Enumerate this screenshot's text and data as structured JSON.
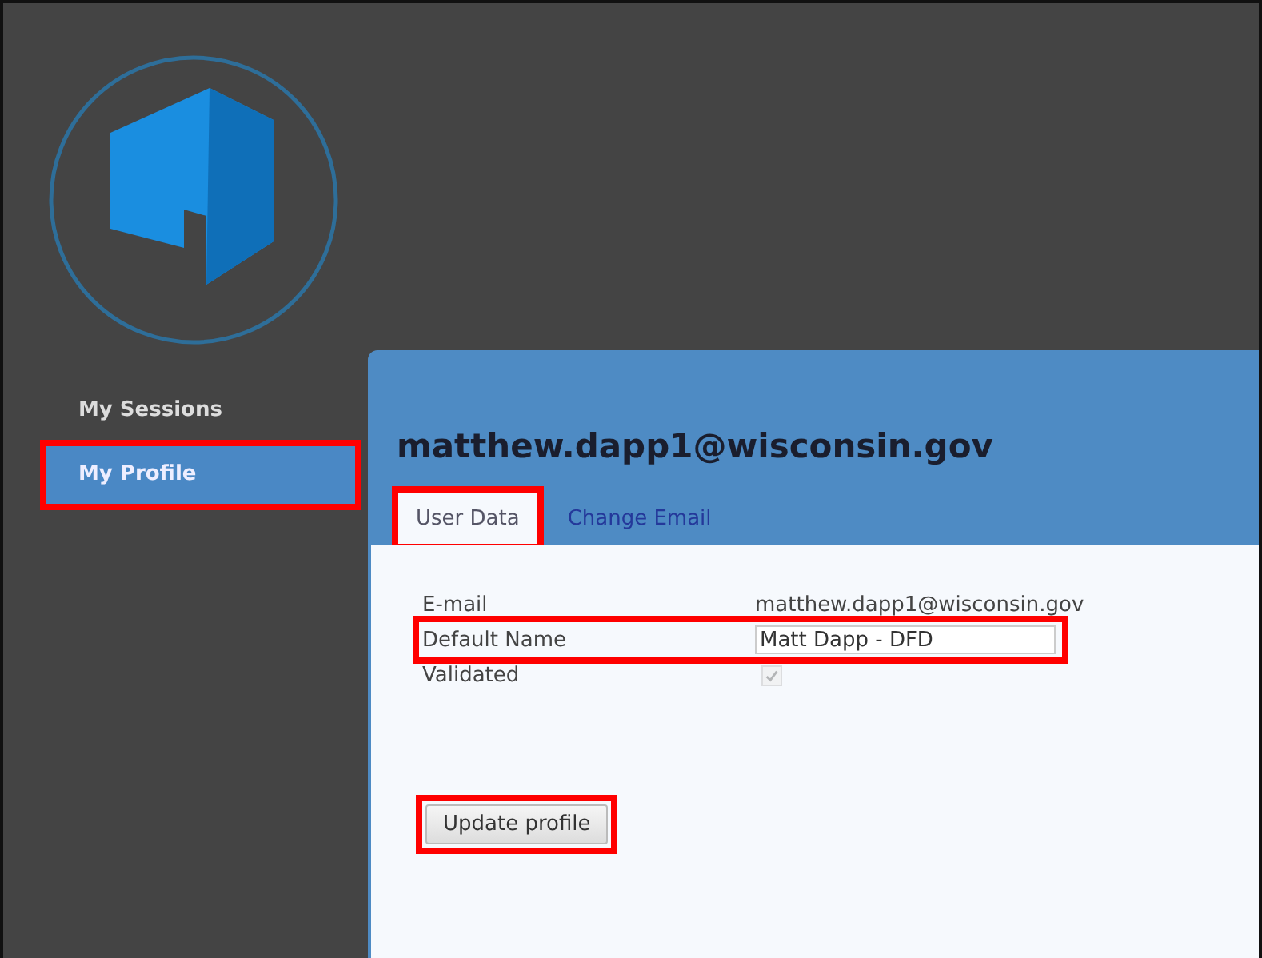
{
  "sidebar": {
    "items": [
      {
        "label": "My Sessions",
        "selected": false,
        "highlighted": false
      },
      {
        "label": "My Profile",
        "selected": true,
        "highlighted": true
      }
    ]
  },
  "profile": {
    "title": "matthew.dapp1@wisconsin.gov",
    "tabs": [
      {
        "label": "User Data",
        "selected": true,
        "highlighted": true
      },
      {
        "label": "Change Email",
        "selected": false,
        "highlighted": false
      }
    ],
    "fields": [
      {
        "kind": "text",
        "label": "E-mail",
        "value": "matthew.dapp1@wisconsin.gov",
        "highlighted": false
      },
      {
        "kind": "input",
        "label": "Default Name",
        "value": "Matt Dapp - DFD",
        "highlighted": true
      },
      {
        "kind": "checkbox",
        "label": "Validated",
        "checked": true,
        "disabled": true,
        "highlighted": false
      }
    ],
    "button": {
      "label": "Update profile",
      "highlighted": true
    }
  }
}
